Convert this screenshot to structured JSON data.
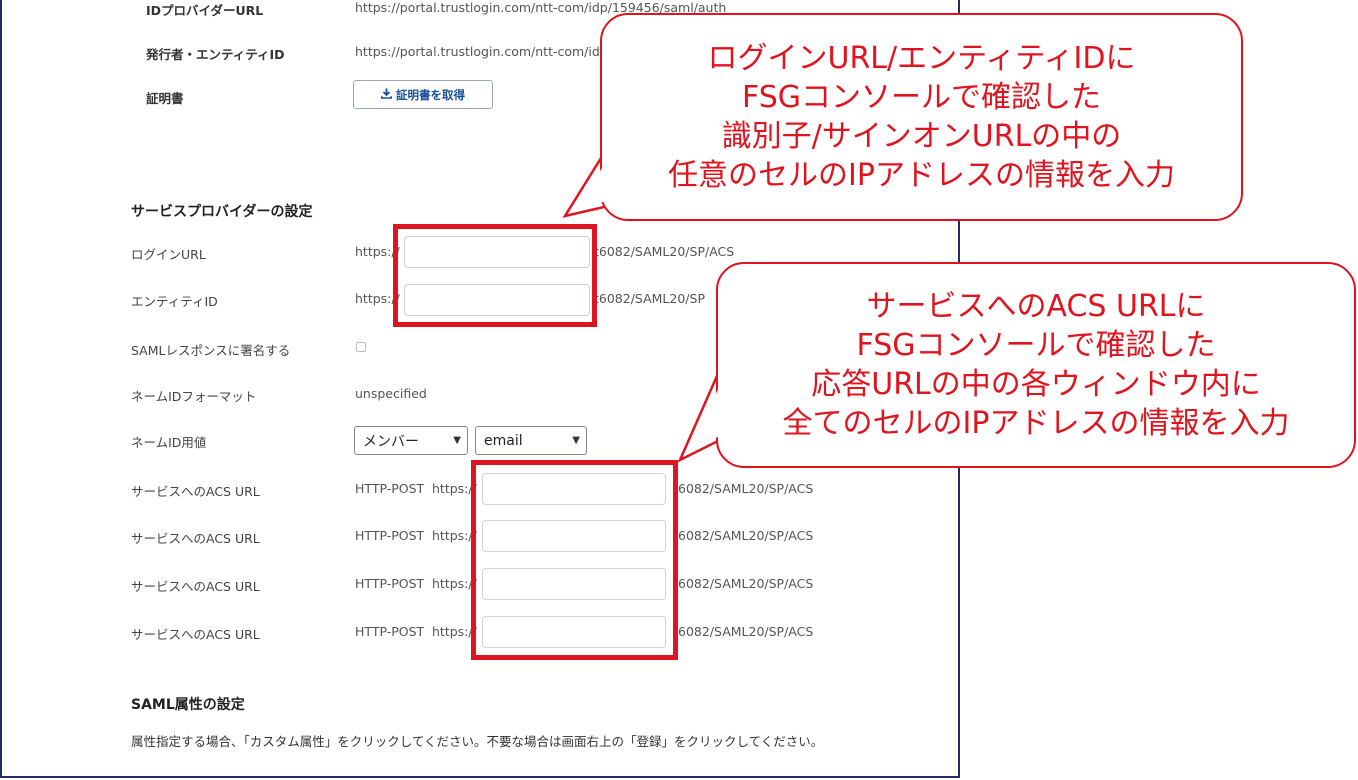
{
  "idp": {
    "idp_url_label": "IDプロバイダーURL",
    "idp_url_value": "https://portal.trustlogin.com/ntt-com/idp/159456/saml/auth",
    "issuer_label": "発行者・エンティティID",
    "issuer_value": "https://portal.trustlogin.com/ntt-com/idp/",
    "cert_label": "証明書",
    "cert_button": "証明書を取得"
  },
  "sp": {
    "section_title": "サービスプロバイダーの設定",
    "login_url_label": "ログインURL",
    "login_url_prefix": "https://",
    "login_url_suffix": "t6082/SAML20/SP/ACS",
    "entity_id_label": "エンティティID",
    "entity_id_prefix": "https://",
    "entity_id_suffix": "t6082/SAML20/SP",
    "sign_label": "SAMLレスポンスに署名する",
    "nameid_format_label": "ネームIDフォーマット",
    "nameid_format_value": "unspecified",
    "nameid_value_label": "ネームID用値",
    "nameid_select1": "メンバー",
    "nameid_select2": "email",
    "acs_rows": [
      {
        "label": "サービスへのACS URL",
        "method": "HTTP-POST",
        "prefix": "https://",
        "suffix": "6082/SAML20/SP/ACS"
      },
      {
        "label": "サービスへのACS URL",
        "method": "HTTP-POST",
        "prefix": "https://",
        "suffix": "6082/SAML20/SP/ACS"
      },
      {
        "label": "サービスへのACS URL",
        "method": "HTTP-POST",
        "prefix": "https://",
        "suffix": "6082/SAML20/SP/ACS"
      },
      {
        "label": "サービスへのACS URL",
        "method": "HTTP-POST",
        "prefix": "https://",
        "suffix": "6082/SAML20/SP/ACS"
      }
    ]
  },
  "attrs": {
    "section_title": "SAML属性の設定",
    "description": "属性指定する場合、「カスタム属性」をクリックしてください。不要な場合は画面右上の「登録」をクリックしてください。"
  },
  "callout1": {
    "lines": [
      "ログインURL/エンティティIDに",
      "FSGコンソールで確認した",
      "識別子/サインオンURLの中の",
      "任意のセルのIPアドレスの情報を入力"
    ]
  },
  "callout2": {
    "lines": [
      "サービスへのACS URLに",
      "FSGコンソールで確認した",
      "応答URLの中の各ウィンドウ内に",
      "全てのセルのIPアドレスの情報を入力"
    ]
  },
  "colors": {
    "annotation": "#e0141e",
    "frame": "#1f2f5f",
    "link": "#1a4f9a"
  },
  "icons": {
    "download": "download-icon",
    "dropdown": "chevron-down-icon"
  }
}
